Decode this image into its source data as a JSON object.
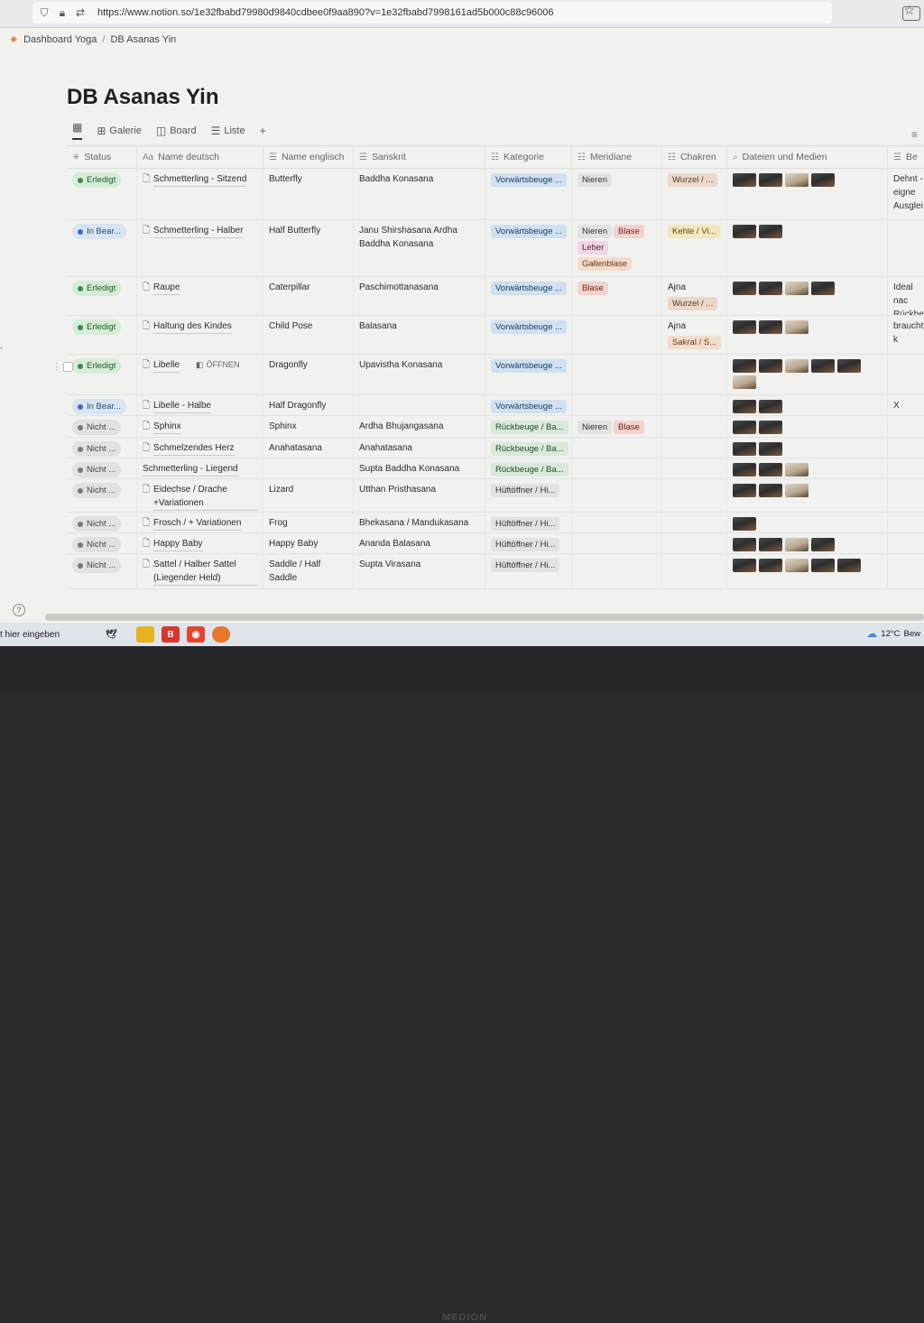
{
  "browser": {
    "url": "https://www.notion.so/1e32fbabd79980d9840cdbee0f9aa890?v=1e32fbabd7998161ad5b000c88c96006"
  },
  "breadcrumb": {
    "items": [
      "Dashboard Yoga",
      "DB Asanas Yin"
    ]
  },
  "page_title": "DB Asanas Yin",
  "views": [
    {
      "label": "",
      "icon": "table-icon"
    },
    {
      "label": "Galerie",
      "icon": "gallery-icon"
    },
    {
      "label": "Board",
      "icon": "board-icon"
    },
    {
      "label": "Liste",
      "icon": "list-icon"
    },
    {
      "label": "+",
      "icon": "plus-icon"
    }
  ],
  "columns": [
    "Status",
    "Name deutsch",
    "Name englisch",
    "Sanskrit",
    "Kategorie",
    "Meridiane",
    "Chakren",
    "Dateien und Medien",
    "Be"
  ],
  "open_label": "ÖFFNEN",
  "rows": [
    {
      "status": "Erledigt",
      "status_type": "done",
      "de": "Schmetterling - Sitzend",
      "en": "Butterfly",
      "sa": "Baddha Konasana",
      "kat": "Vorwärtsbeuge ...",
      "kat_color": "blue",
      "meridiane": [
        {
          "t": "Nieren",
          "c": "gray"
        }
      ],
      "chakren": [
        {
          "t": "Wurzel / ...",
          "c": "brown"
        }
      ],
      "chakren_plain": [],
      "thumbs": 4,
      "note": "Dehnt - eigne Ausglei"
    },
    {
      "status": "In Bear...",
      "status_type": "prog",
      "de": "Schmetterling - Halber",
      "en": "Half Butterfly",
      "sa": "Janu Shirshasana Ardha Baddha Konasana",
      "kat": "Vorwärtsbeuge ...",
      "kat_color": "blue",
      "meridiane": [
        {
          "t": "Nieren",
          "c": "gray"
        },
        {
          "t": "Blase",
          "c": "red"
        },
        {
          "t": "Leber",
          "c": "pink"
        },
        {
          "t": "Gallenblase",
          "c": "orange"
        }
      ],
      "chakren": [
        {
          "t": "Kehle / Vi...",
          "c": "yellow"
        }
      ],
      "chakren_plain": [],
      "thumbs": 2,
      "note": ""
    },
    {
      "status": "Erledigt",
      "status_type": "done",
      "de": "Raupe",
      "en": "Caterpillar",
      "sa": "Paschimottanasana",
      "kat": "Vorwärtsbeuge ...",
      "kat_color": "blue",
      "meridiane": [
        {
          "t": "Blase",
          "c": "red"
        }
      ],
      "chakren": [
        {
          "t": "Wurzel / ...",
          "c": "brown"
        }
      ],
      "chakren_plain": [
        "Ajna"
      ],
      "thumbs": 4,
      "note": "Ideal nac Rückbeu"
    },
    {
      "status": "Erledigt",
      "status_type": "done",
      "de": "Haltung des Kindes",
      "en": "Child Pose",
      "sa": "Balasana",
      "kat": "Vorwärtsbeuge ...",
      "kat_color": "blue",
      "meridiane": [],
      "chakren": [
        {
          "t": "Sakral / S...",
          "c": "orange"
        }
      ],
      "chakren_plain": [
        "Ajna"
      ],
      "thumbs": 3,
      "note": "braucht k"
    },
    {
      "status": "Erledigt",
      "status_type": "done",
      "de": "Libelle",
      "en": "Dragonfly",
      "sa": "Upavistha Konasana",
      "kat": "Vorwärtsbeuge ...",
      "kat_color": "blue",
      "meridiane": [],
      "chakren": [],
      "chakren_plain": [],
      "thumbs": 6,
      "note": "",
      "open": true
    },
    {
      "status": "In Bear...",
      "status_type": "prog",
      "de": "Libelle - Halbe",
      "en": "Half Dragonfly",
      "sa": "",
      "kat": "Vorwärtsbeuge ...",
      "kat_color": "blue",
      "meridiane": [],
      "chakren": [],
      "chakren_plain": [],
      "thumbs": 2,
      "note": "X"
    },
    {
      "status": "Nicht ...",
      "status_type": "not",
      "de": "Sphinx",
      "en": "Sphinx",
      "sa": "Ardha Bhujangasana",
      "kat": "Rückbeuge / Ba...",
      "kat_color": "green",
      "meridiane": [
        {
          "t": "Nieren",
          "c": "gray"
        },
        {
          "t": "Blase",
          "c": "red"
        }
      ],
      "chakren": [],
      "chakren_plain": [],
      "thumbs": 2,
      "note": ""
    },
    {
      "status": "Nicht ...",
      "status_type": "not",
      "de": "Schmelzendes Herz",
      "en": "Anahatasana",
      "sa": "Anahatasana",
      "kat": "Rückbeuge / Ba...",
      "kat_color": "green",
      "meridiane": [],
      "chakren": [],
      "chakren_plain": [],
      "thumbs": 2,
      "note": ""
    },
    {
      "status": "Nicht ...",
      "status_type": "not",
      "de": "Schmetterling - Liegend",
      "en": "",
      "sa": "Supta Baddha Konasana",
      "kat": "Rückbeuge / Ba...",
      "kat_color": "green",
      "meridiane": [],
      "chakren": [],
      "chakren_plain": [],
      "thumbs": 3,
      "note": "",
      "no_doc": true
    },
    {
      "status": "Nicht ...",
      "status_type": "not",
      "de": "Eidechse / Drache +Variationen",
      "en": "Lizard",
      "sa": "Utthan Pristhasana",
      "kat": "Hüftöffner / Hi...",
      "kat_color": "gray",
      "meridiane": [],
      "chakren": [],
      "chakren_plain": [],
      "thumbs": 3,
      "note": ""
    },
    {
      "status": "Nicht ...",
      "status_type": "not",
      "de": "Frosch / + Variationen",
      "en": "Frog",
      "sa": "Bhekasana / Mandukasana",
      "kat": "Hüftöffner / Hi...",
      "kat_color": "gray",
      "meridiane": [],
      "chakren": [],
      "chakren_plain": [],
      "thumbs": 1,
      "note": ""
    },
    {
      "status": "Nicht ...",
      "status_type": "not",
      "de": "Happy Baby",
      "en": "Happy Baby",
      "sa": "Ananda Balasana",
      "kat": "Hüftöffner / Hi...",
      "kat_color": "gray",
      "meridiane": [],
      "chakren": [],
      "chakren_plain": [],
      "thumbs": 4,
      "note": ""
    },
    {
      "status": "Nicht ...",
      "status_type": "not",
      "de": "Sattel / Halber Sattel (Liegender Held)",
      "en": "Saddle / Half Saddle",
      "sa": "Supta Virasana",
      "kat": "Hüftöffner / Hi...",
      "kat_color": "gray",
      "meridiane": [],
      "chakren": [],
      "chakren_plain": [],
      "thumbs": 5,
      "note": ""
    }
  ],
  "taskbar": {
    "search_text": "t hier eingeben",
    "app_b": "B",
    "weather_temp": "12°C",
    "weather_text": "Bew"
  },
  "monitor_brand": "MEDION"
}
